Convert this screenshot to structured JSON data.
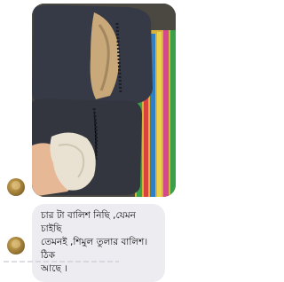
{
  "thread": {
    "messages": [
      {
        "type": "image",
        "alt": ""
      },
      {
        "type": "text",
        "text": "চার টা বালিশ নিছি ,যেমন চাইছি\nতেমনই ,শিমুল তুলার বালিশ।ঠিক\nআছে ।"
      }
    ]
  },
  "colors": {
    "bubble": "#ececf1",
    "text": "#111111"
  },
  "icons": {
    "sender_avatar": "avatar"
  }
}
